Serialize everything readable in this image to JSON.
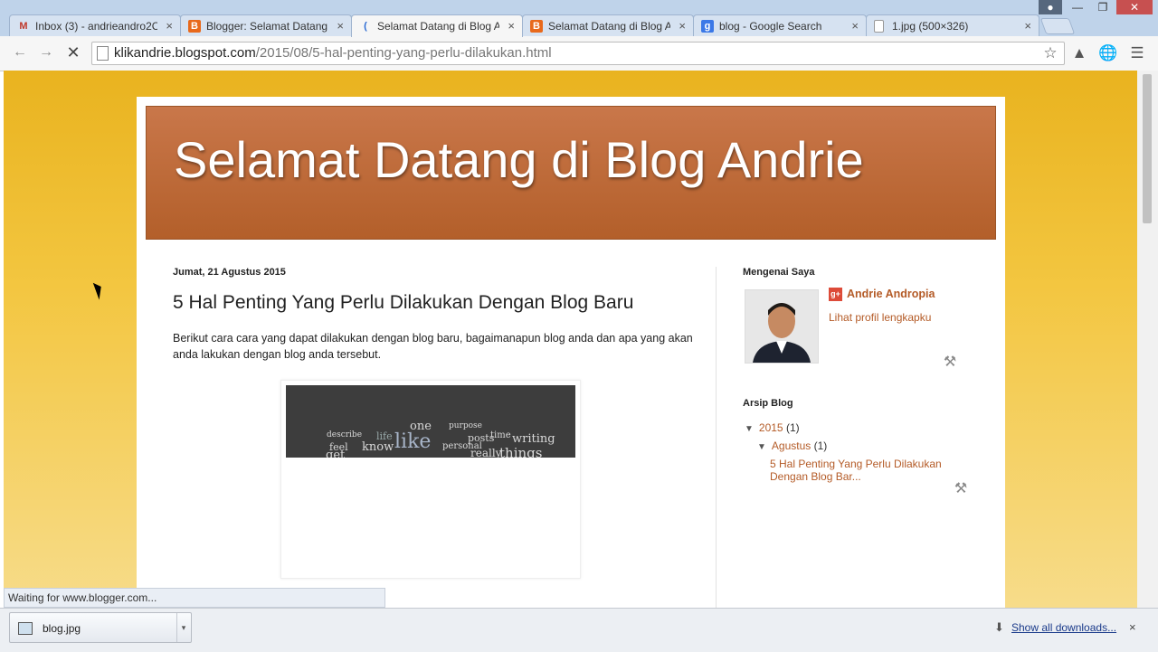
{
  "tabs": [
    {
      "label": "Inbox (3) - andrieandro2C",
      "icon": "gmail-icon",
      "icon_text": "M",
      "color": "#c0392b"
    },
    {
      "label": "Blogger: Selamat Datang",
      "icon": "blogger-icon",
      "icon_text": "B",
      "color": "#e8691c"
    },
    {
      "label": "Selamat Datang di Blog A",
      "icon": "loading-icon",
      "icon_text": "(",
      "color": "#2a6ad3"
    },
    {
      "label": "Selamat Datang di Blog A",
      "icon": "blogger-icon",
      "icon_text": "B",
      "color": "#e8691c"
    },
    {
      "label": "blog - Google Search",
      "icon": "google-icon",
      "icon_text": "g",
      "color": "#3b78e7"
    },
    {
      "label": "1.jpg (500×326)",
      "icon": "image-file-icon",
      "icon_text": "",
      "color": "#999999"
    }
  ],
  "tab_close": "×",
  "address": {
    "domain": "klikandrie.blogspot.com",
    "path": "/2015/08/5-hal-penting-yang-perlu-dilakukan.html"
  },
  "blog": {
    "title": "Selamat Datang di Blog Andrie",
    "date": "Jumat, 21 Agustus 2015",
    "post_title": "5 Hal Penting Yang Perlu Dilakukan Dengan Blog Baru",
    "post_body": "Berikut cara cara yang dapat dilakukan dengan blog baru, bagaimanapun blog anda dan apa yang akan anda lakukan dengan blog anda tersebut.",
    "cloud_words": [
      "one",
      "like",
      "know",
      "writing",
      "things",
      "posts",
      "time",
      "feel",
      "life",
      "personal",
      "describe",
      "purpose",
      "get",
      "really"
    ]
  },
  "sidebar": {
    "about_heading": "Mengenai Saya",
    "gplus_text": "g+",
    "author": "Andrie Andropia",
    "profile_link": "Lihat profil lengkapku",
    "archive_heading": "Arsip Blog",
    "year": "2015",
    "year_count": "(1)",
    "month": "Agustus",
    "month_count": "(1)",
    "archive_post": "5 Hal Penting Yang Perlu Dilakukan Dengan Blog Bar..."
  },
  "status": "Waiting for www.blogger.com...",
  "downloads": {
    "file": "blog.jpg",
    "show_all": "Show all downloads...",
    "close": "×"
  }
}
